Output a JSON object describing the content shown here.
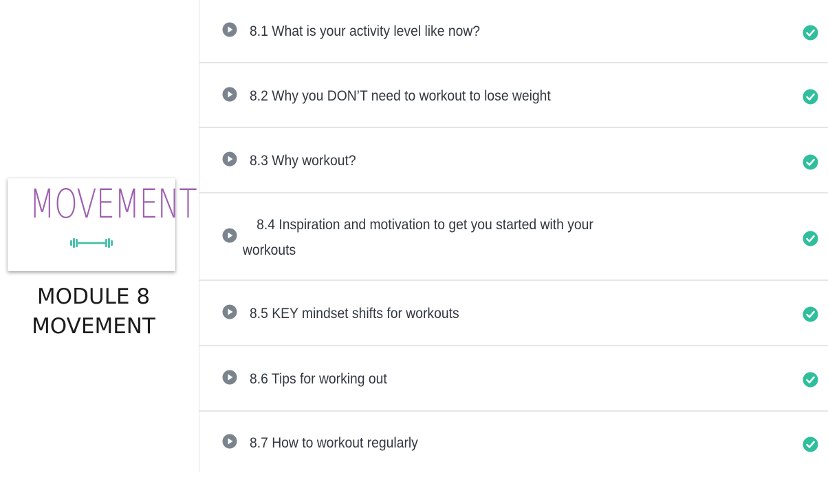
{
  "thumbnail": {
    "word": "MOVEMENT",
    "icon": "dumbbell-icon",
    "word_color": "#9e5fb0",
    "icon_color": "#4cc0ad"
  },
  "module": {
    "line1": "MODULE 8",
    "line2": "MOVEMENT"
  },
  "colors": {
    "play": "#7b848e",
    "complete": "#2fbf9c",
    "divider": "#e6e6e6"
  },
  "lessons": [
    {
      "title": "8.1 What is your activity level like now?",
      "status": "complete"
    },
    {
      "title": "8.2 Why you DON’T need to workout to lose weight",
      "status": "complete"
    },
    {
      "title": "8.3 Why workout?",
      "status": "complete"
    },
    {
      "title_line1": "8.4 Inspiration and motivation to get you started with your",
      "title_line2": "workouts",
      "status": "complete"
    },
    {
      "title": "8.5 KEY mindset shifts for workouts",
      "status": "complete"
    },
    {
      "title": "8.6 Tips for working out",
      "status": "complete"
    },
    {
      "title": "8.7 How to workout regularly",
      "status": "complete"
    }
  ]
}
